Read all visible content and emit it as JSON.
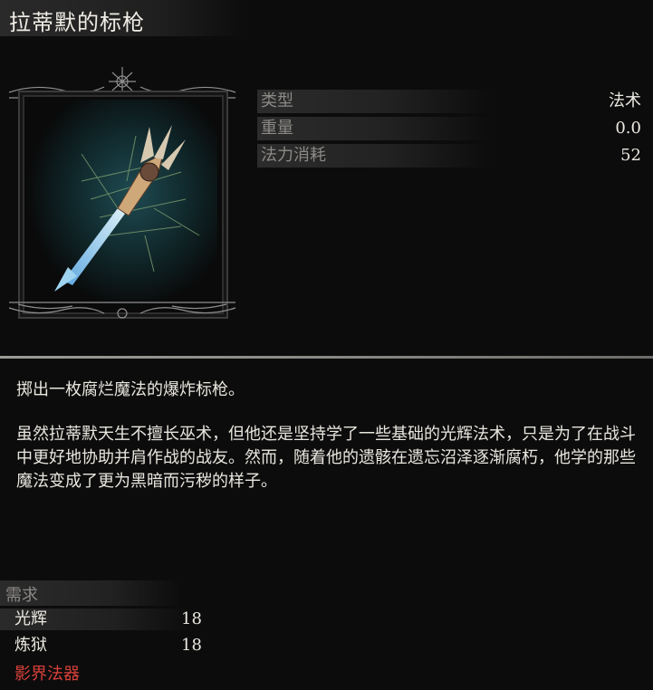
{
  "item": {
    "name": "拉蒂默的标枪",
    "image_icon": "spectral-spear-icon"
  },
  "stats": [
    {
      "label": "类型",
      "value": "法术"
    },
    {
      "label": "重量",
      "value": "0.0"
    },
    {
      "label": "法力消耗",
      "value": "52"
    }
  ],
  "description": {
    "summary": "掷出一枚腐烂魔法的爆炸标枪。",
    "lore": "虽然拉蒂默天生不擅长巫术，但他还是坚持学了一些基础的光辉法术，只是为了在战斗中更好地协助并肩作战的战友。然而，随着他的遗骸在遗忘沼泽逐渐腐朽，他学的那些魔法变成了更为黑暗而污秽的样子。"
  },
  "requirements": {
    "header": "需求",
    "rows": [
      {
        "label": "光辉",
        "value": "18"
      },
      {
        "label": "炼狱",
        "value": "18"
      }
    ],
    "category": "影界法器"
  },
  "colors": {
    "background": "#0c0c0c",
    "label_gray": "#8c8a86",
    "text": "#e9e6df",
    "category_red": "#d9413b"
  }
}
